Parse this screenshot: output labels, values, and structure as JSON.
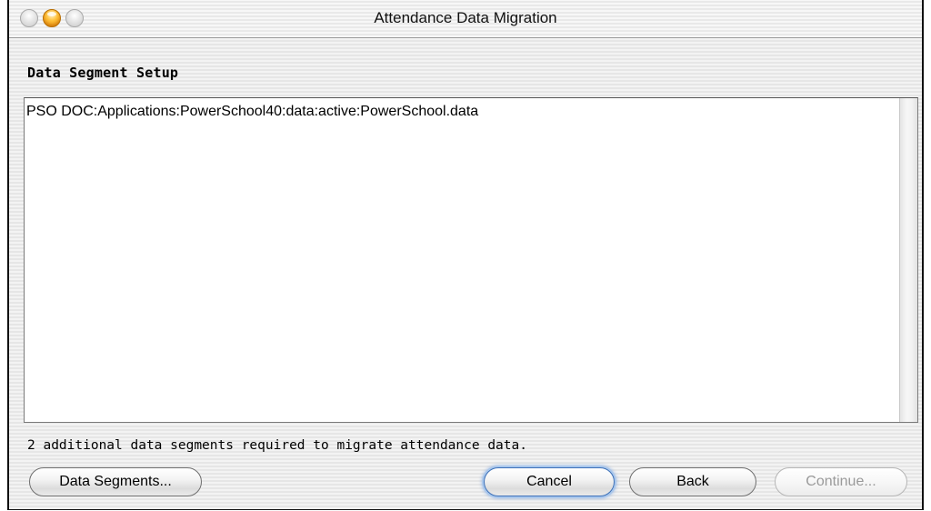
{
  "window": {
    "title": "Attendance Data Migration"
  },
  "section": {
    "title": "Data Segment Setup"
  },
  "segments": {
    "items": [
      "PSO DOC:Applications:PowerSchool40:data:active:PowerSchool.data"
    ]
  },
  "status": {
    "message": "2 additional data segments required to migrate attendance data."
  },
  "buttons": {
    "data_segments": "Data Segments...",
    "cancel": "Cancel",
    "back": "Back",
    "continue": "Continue..."
  }
}
